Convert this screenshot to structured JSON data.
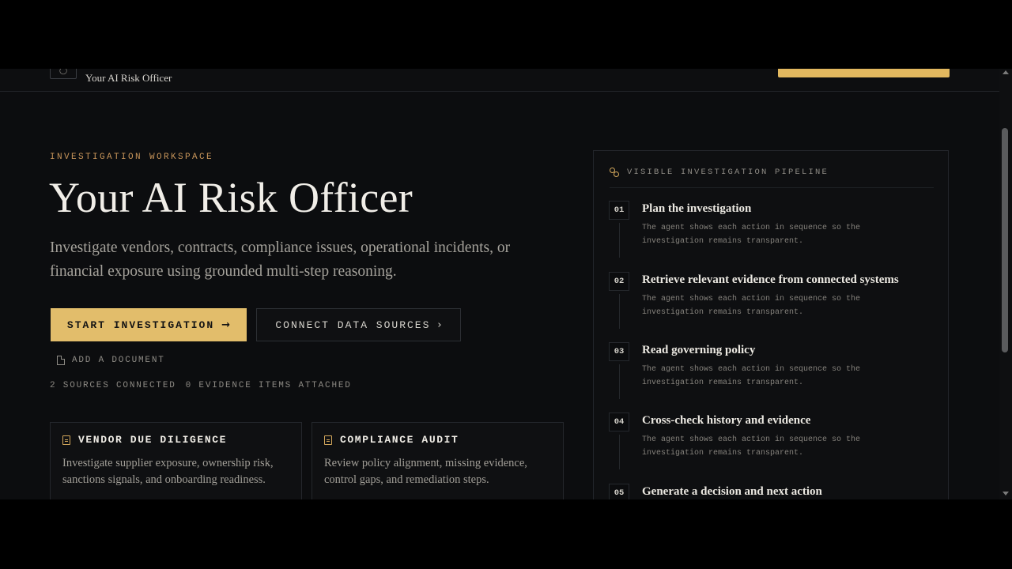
{
  "nav": {
    "brand_icon": "shield-icon",
    "brand_name": "Your AI Risk Officer"
  },
  "hero": {
    "eyebrow": "INVESTIGATION WORKSPACE",
    "title": "Your AI Risk Officer",
    "description": "Investigate vendors, contracts, compliance issues, operational incidents, or financial exposure using grounded multi-step reasoning.",
    "primary_cta": "START INVESTIGATION",
    "secondary_cta": "CONNECT DATA SOURCES",
    "add_document": "ADD A DOCUMENT",
    "sources_connected": "2 SOURCES CONNECTED",
    "evidence_attached": "0 EVIDENCE ITEMS ATTACHED"
  },
  "cards": [
    {
      "title": "VENDOR DUE DILIGENCE",
      "description": "Investigate supplier exposure, ownership risk, sanctions signals, and onboarding readiness."
    },
    {
      "title": "COMPLIANCE AUDIT",
      "description": "Review policy alignment, missing evidence, control gaps, and remediation steps."
    }
  ],
  "pipeline": {
    "heading": "VISIBLE INVESTIGATION PIPELINE",
    "steps": [
      {
        "num": "01",
        "title": "Plan the investigation",
        "description": "The agent shows each action in sequence so the investigation remains transparent."
      },
      {
        "num": "02",
        "title": "Retrieve relevant evidence from connected systems",
        "description": "The agent shows each action in sequence so the investigation remains transparent."
      },
      {
        "num": "03",
        "title": "Read governing policy",
        "description": "The agent shows each action in sequence so the investigation remains transparent."
      },
      {
        "num": "04",
        "title": "Cross-check history and evidence",
        "description": "The agent shows each action in sequence so the investigation remains transparent."
      },
      {
        "num": "05",
        "title": "Generate a decision and next action",
        "description": ""
      }
    ]
  },
  "colors": {
    "accent": "#e2bd6b",
    "eyebrow": "#c8955a",
    "background": "#0c0d0f"
  }
}
